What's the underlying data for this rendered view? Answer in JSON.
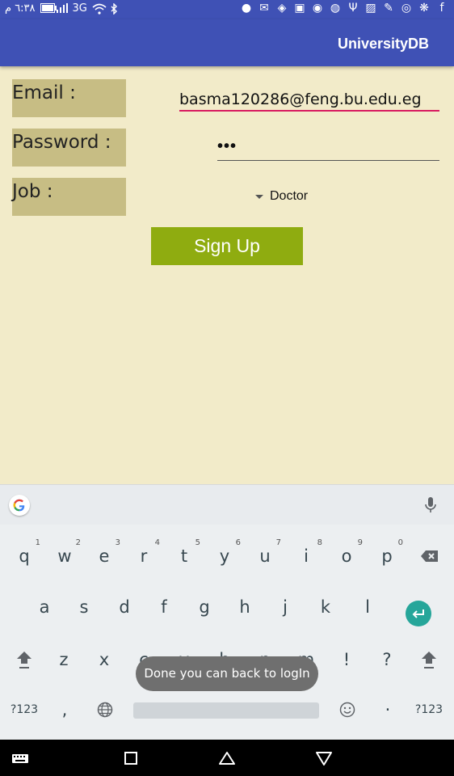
{
  "status_bar": {
    "time": "٦:٣٨ م",
    "network": "3G"
  },
  "app_bar": {
    "title": "UniversityDB"
  },
  "form": {
    "email_label": "Email :",
    "password_label": "Password :",
    "job_label": "Job :",
    "email_value": "basma120286@feng.bu.edu.eg",
    "password_value": "•••",
    "job_selected": "Doctor",
    "signup_label": "Sign Up"
  },
  "keyboard": {
    "row1": [
      {
        "key": "q",
        "hint": "1"
      },
      {
        "key": "w",
        "hint": "2"
      },
      {
        "key": "e",
        "hint": "3"
      },
      {
        "key": "r",
        "hint": "4"
      },
      {
        "key": "t",
        "hint": "5"
      },
      {
        "key": "y",
        "hint": "6"
      },
      {
        "key": "u",
        "hint": "7"
      },
      {
        "key": "i",
        "hint": "8"
      },
      {
        "key": "o",
        "hint": "9"
      },
      {
        "key": "p",
        "hint": "0"
      }
    ],
    "row2": [
      "a",
      "s",
      "d",
      "f",
      "g",
      "h",
      "j",
      "k",
      "l"
    ],
    "row3": [
      "z",
      "x",
      "c",
      "v",
      "b",
      "n",
      "m",
      "!",
      "?"
    ],
    "symbols_label": "?123",
    "comma": ",",
    "period": "·"
  },
  "toast": {
    "message": "Done you can back to logIn"
  },
  "colors": {
    "primary": "#3f51b5",
    "accent": "#d81b60",
    "button": "#8fac10",
    "label_bg": "#c7bd84",
    "background": "#f2ebc9"
  }
}
